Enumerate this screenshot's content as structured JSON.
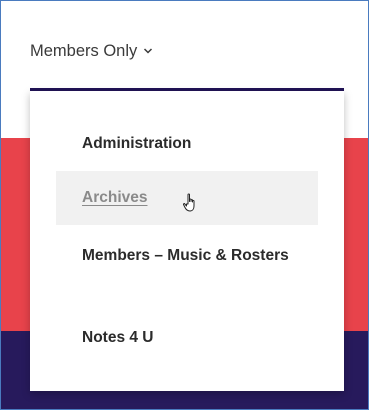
{
  "nav": {
    "trigger_label": "Members Only",
    "accent_underline": "#211356"
  },
  "dropdown": {
    "items": [
      {
        "label": "Administration",
        "state": "default"
      },
      {
        "label": "Archives",
        "state": "hover"
      },
      {
        "label": "Members – Music & Rosters",
        "state": "default"
      },
      {
        "label": "Notes 4 U",
        "state": "default"
      }
    ]
  },
  "colors": {
    "background_red": "#e8434b",
    "background_navy": "#271a5c"
  },
  "icons": {
    "trigger": "chevron-down-icon",
    "pointer": "hand-pointer-cursor-icon"
  }
}
